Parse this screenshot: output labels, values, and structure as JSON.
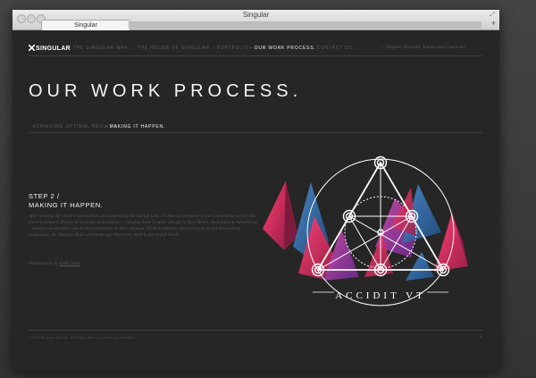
{
  "window": {
    "title": "Singular",
    "tab_label": "Singular",
    "new_tab_icon": "+",
    "resize_icon": "⤢"
  },
  "header": {
    "logo_text": "SINGULAR",
    "nav": [
      {
        "label": "- THE SINGULAR WAY.",
        "active": false
      },
      {
        "label": "- THE HOUSE OF SINGULAR.",
        "active": false
      },
      {
        "label": "- PORTFOLIO.",
        "active": false
      },
      {
        "label": "- OUR WORK PROCESS.",
        "active": true
      },
      {
        "label": "- CONTACT US.",
        "active": false
      }
    ],
    "tagline": "— Singular Diversity, Intellectual Character."
  },
  "page": {
    "title": "OUR WORK PROCESS.",
    "subnav": [
      {
        "label": "- ACHIEVING OPTIMAL RESULTS.",
        "active": false
      },
      {
        "label": "- MAKING IT HAPPEN.",
        "active": true
      }
    ],
    "step_title_line1": "STEP 2 /",
    "step_title_line2": "MAKING IT HAPPEN.",
    "body_text": "After meeting the client's expectations and generating the startup idea, it's time to transform it into a smashing reality. Our team is uniquely diverse in its scope of disciplines – ranging from Graphic Design to New Media, Animation & Advertising – and are not afraid to use the full knowledge at their disposal. From traditional advertising to Social Networking campaigns, the Singular Team will make sure that every need is met in full detail.",
    "photo_credit_prefix": "Photography by",
    "photo_credit_name": "Edith Valle",
    "artwork_motto": "ACCIDIT VT"
  },
  "footer": {
    "copyright": "©2012 Singular Brands. All Rights Reserved. Code by Medulaar.",
    "page_number": "2"
  },
  "colors": {
    "background": "#262626",
    "accent_pink": "#e0305e",
    "accent_blue": "#3a7fc1",
    "accent_magenta": "#c24ca3",
    "text_light": "#f4f4f4",
    "text_dim": "#5c5c5c"
  }
}
